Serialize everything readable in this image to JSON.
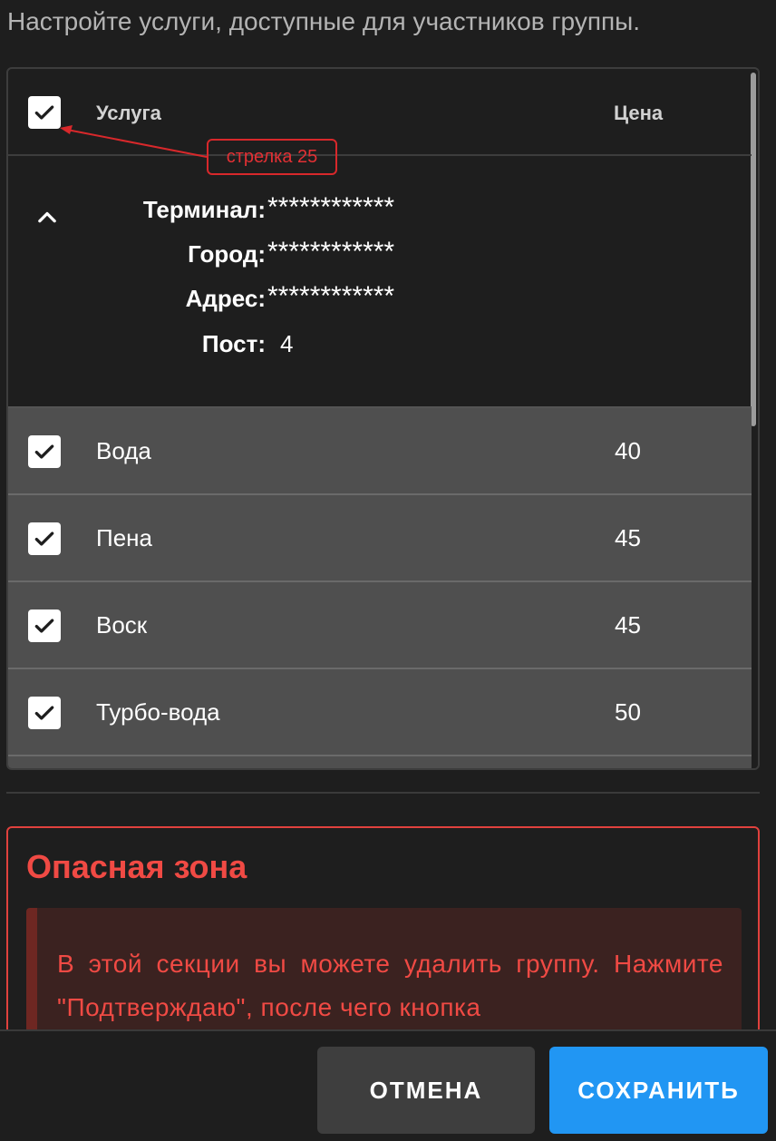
{
  "intro": "Настройте услуги, доступные для участников группы.",
  "table": {
    "header": {
      "service": "Услуга",
      "price": "Цена"
    },
    "group": {
      "terminal_label": "Терминал:",
      "terminal_value": "************",
      "city_label": "Город:",
      "city_value": "************",
      "address_label": "Адрес:",
      "address_value": "************",
      "post_label": "Пост:",
      "post_value": "4"
    },
    "rows": [
      {
        "name": "Вода",
        "price": "40"
      },
      {
        "name": "Пена",
        "price": "45"
      },
      {
        "name": "Воск",
        "price": "45"
      },
      {
        "name": "Турбо-вода",
        "price": "50"
      }
    ]
  },
  "annotation": "стрелка 25",
  "danger": {
    "title": "Опасная зона",
    "message": "В этой секции вы можете удалить группу. Нажмите \"Подтверждаю\", после чего кнопка"
  },
  "footer": {
    "cancel": "ОТМЕНА",
    "save": "СОХРАНИТЬ"
  },
  "colors": {
    "accent": "#2196f3",
    "danger": "#f04a44",
    "annotation": "#d8282b"
  }
}
